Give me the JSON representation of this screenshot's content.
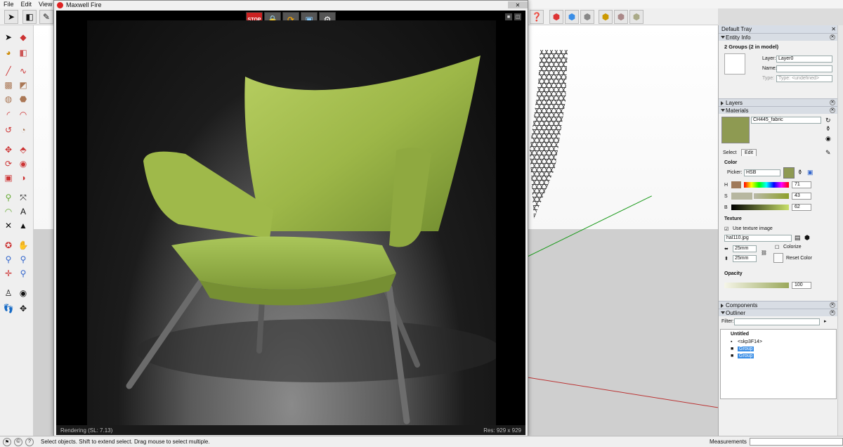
{
  "menu": [
    "File",
    "Edit",
    "View"
  ],
  "fire_window": {
    "title": "Maxwell Fire",
    "status_left": "Rendering (SL: 7.13)",
    "status_right": "Res: 929 x 929",
    "toolbar": [
      "STOP"
    ]
  },
  "tray": {
    "title": "Default Tray",
    "entity_info": {
      "header": "Entity Info",
      "selection": "2 Groups (2 in model)",
      "layer_label": "Layer:",
      "layer_value": "Layer0",
      "name_label": "Name:",
      "type_label": "Type:",
      "type_value": "Type: <undefined>"
    },
    "layers_header": "Layers",
    "materials": {
      "header": "Materials",
      "name": "CH445_fabric",
      "tab_select": "Select",
      "tab_edit": "Edit",
      "color_label": "Color",
      "picker_label": "Picker:",
      "picker_value": "HSB",
      "h_label": "H",
      "s_label": "S",
      "b_label": "B",
      "h_value": "71",
      "s_value": "43",
      "b_value": "62",
      "texture_label": "Texture",
      "use_texture_label": "Use texture image",
      "texture_file": "hal110.jpg",
      "width": "25mm",
      "height": "25mm",
      "colorize": "Colorize",
      "reset_color": "Reset Color",
      "opacity_label": "Opacity",
      "opacity_value": "100",
      "swatch_color": "#8e9a52"
    },
    "components_header": "Components",
    "outliner": {
      "header": "Outliner",
      "filter_label": "Filter:",
      "root": "Untitled",
      "items": [
        "<skp3F14>",
        "Group",
        "Group"
      ]
    }
  },
  "statusbar": {
    "text": "Select objects. Shift to extend select. Drag mouse to select multiple.",
    "measurements": "Measurements"
  },
  "colors": {
    "chair_fabric": "#9db748",
    "accent_blue": "#3a8ee6"
  }
}
